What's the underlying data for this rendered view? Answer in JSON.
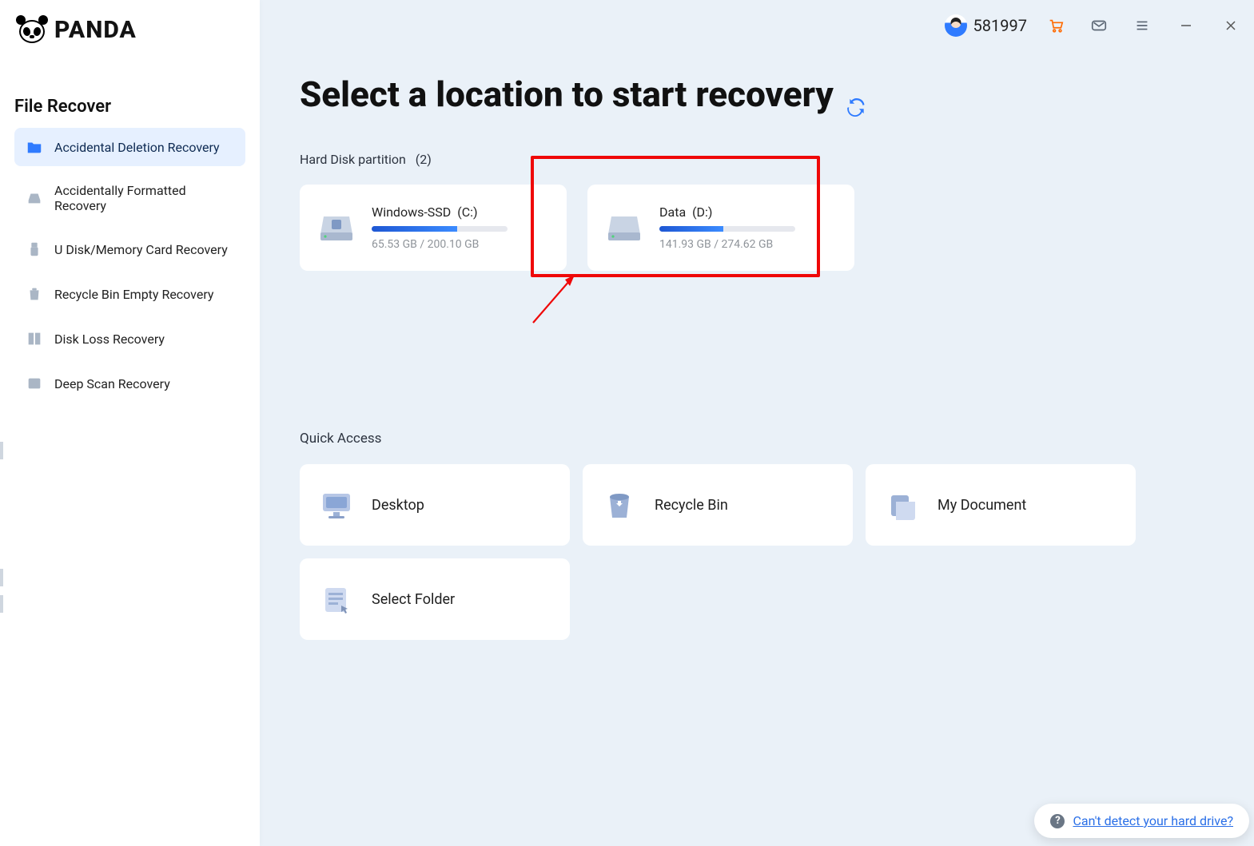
{
  "brand": {
    "name": "PANDA"
  },
  "sidebar": {
    "title": "File Recover",
    "items": [
      {
        "label": "Accidental Deletion Recovery",
        "active": true
      },
      {
        "label": "Accidentally Formatted Recovery",
        "active": false
      },
      {
        "label": "U Disk/Memory Card Recovery",
        "active": false
      },
      {
        "label": "Recycle Bin Empty Recovery",
        "active": false
      },
      {
        "label": "Disk Loss Recovery",
        "active": false
      },
      {
        "label": "Deep Scan Recovery",
        "active": false
      }
    ]
  },
  "header": {
    "user_id": "581997"
  },
  "main": {
    "title": "Select a location to start recovery",
    "hdd_section": {
      "label": "Hard Disk partition",
      "count_display": "(2)"
    },
    "partitions": [
      {
        "name": "Windows-SSD",
        "letter": "(C:)",
        "used": "65.53 GB",
        "total": "200.10 GB",
        "fill_pct": 63
      },
      {
        "name": "Data",
        "letter": "(D:)",
        "used": "141.93 GB",
        "total": "274.62 GB",
        "fill_pct": 47
      }
    ],
    "quick_title": "Quick Access",
    "quick": [
      {
        "label": "Desktop"
      },
      {
        "label": "Recycle Bin"
      },
      {
        "label": "My Document"
      },
      {
        "label": "Select Folder"
      }
    ]
  },
  "help": {
    "link_text": "Can't detect your hard drive?"
  },
  "annotation": {
    "highlighted_partition_index": 1
  }
}
